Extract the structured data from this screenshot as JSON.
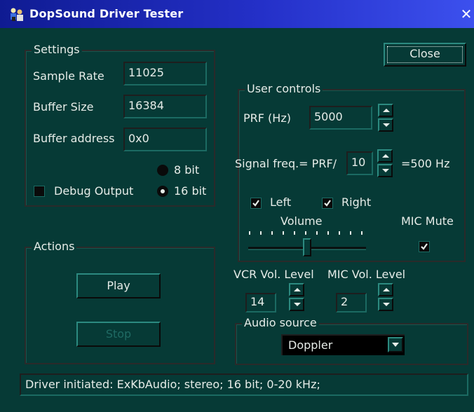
{
  "window": {
    "title": "DopSound Driver Tester",
    "close_glyph": "✕",
    "app_icon": "people-icon"
  },
  "settings": {
    "group_label": "Settings",
    "sample_rate_label": "Sample Rate",
    "sample_rate_value": "11025",
    "buffer_size_label": "Buffer Size",
    "buffer_size_value": "16384",
    "buffer_address_label": "Buffer address",
    "buffer_address_value": "0x0",
    "bit8_label": "8 bit",
    "bit16_label": "16 bit",
    "selected_bits": "16 bit",
    "debug_output_label": "Debug Output",
    "debug_output_checked": false
  },
  "close_button": {
    "label": "Close"
  },
  "user_controls": {
    "group_label": "User controls",
    "prf_label": "PRF (Hz)",
    "prf_value": "5000",
    "signal_freq_label": "Signal freq.= PRF/",
    "signal_divisor_value": "10",
    "signal_result": "=500 Hz",
    "left_label": "Left",
    "left_checked": true,
    "right_label": "Right",
    "right_checked": true,
    "volume_label": "Volume",
    "volume_level": 0.5,
    "mic_mute_label": "MIC Mute",
    "mic_mute_checked": true
  },
  "levels": {
    "vcr_label": "VCR Vol. Level",
    "vcr_value": "14",
    "mic_label": "MIC Vol. Level",
    "mic_value": "2"
  },
  "audio_source": {
    "group_label": "Audio source",
    "selected": "Doppler"
  },
  "actions": {
    "group_label": "Actions",
    "play_label": "Play",
    "stop_label": "Stop"
  },
  "status": {
    "text": "Driver initiated: ExKbAudio; stereo; 16 bit; 0-20 kHz;"
  },
  "colors": {
    "background": "#063a36",
    "titlebar": "#1b26b0",
    "text": "#e6ece8",
    "disabled_text": "#1f6a63"
  }
}
